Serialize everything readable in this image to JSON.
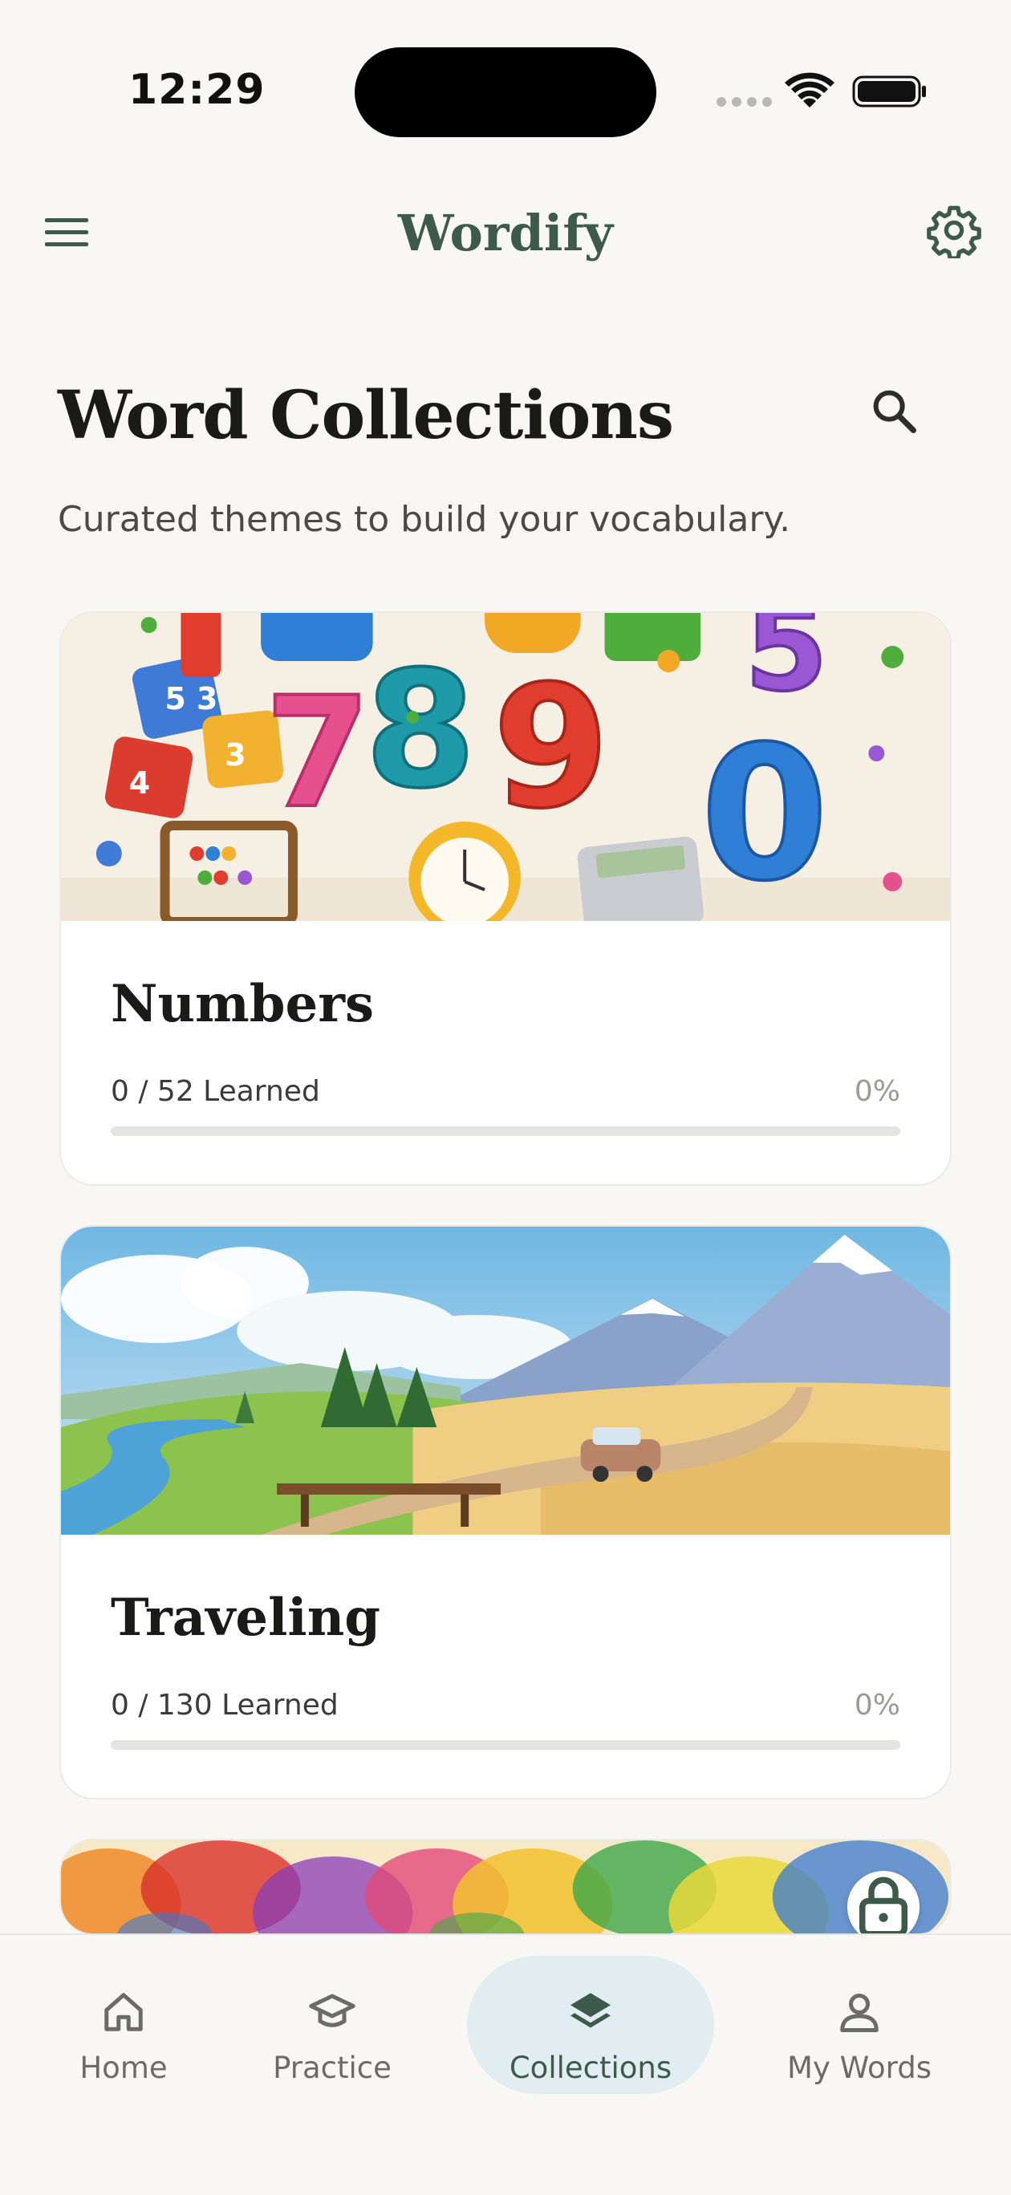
{
  "status_bar": {
    "time": "12:29"
  },
  "header": {
    "title": "Wordify",
    "menu_icon": "hamburger-menu-icon",
    "settings_icon": "gear-icon"
  },
  "page": {
    "title": "Word Collections",
    "subtitle": "Curated themes to build your vocabulary.",
    "search_icon": "search-icon"
  },
  "collections": [
    {
      "title": "Numbers",
      "progress_text": "0 / 52 Learned",
      "percent_label": "0%",
      "progress_fraction": 0,
      "locked": false
    },
    {
      "title": "Traveling",
      "progress_text": "0 / 130 Learned",
      "percent_label": "0%",
      "progress_fraction": 0,
      "locked": false
    },
    {
      "title": "",
      "locked": true
    }
  ],
  "bottom_nav": {
    "items": [
      {
        "label": "Home",
        "icon": "home-icon",
        "active": false
      },
      {
        "label": "Practice",
        "icon": "graduation-cap-icon",
        "active": false
      },
      {
        "label": "Collections",
        "icon": "layers-icon",
        "active": true
      },
      {
        "label": "My Words",
        "icon": "user-icon",
        "active": false
      }
    ]
  },
  "colors": {
    "brand_green": "#3e5a4b",
    "active_nav_bg": "#e2edf2",
    "background": "#f8f7f4"
  }
}
